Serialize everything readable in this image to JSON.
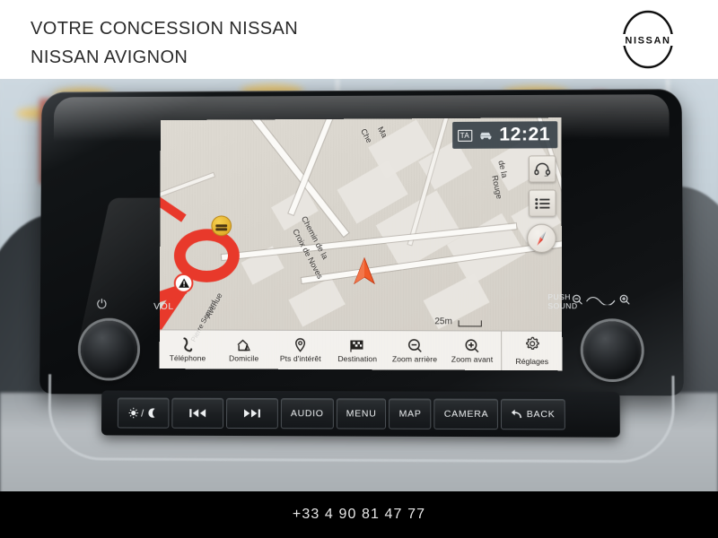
{
  "header": {
    "line1": "VOTRE CONCESSION NISSAN",
    "line2": "NISSAN AVIGNON",
    "logo_text": "NISSAN"
  },
  "footer": {
    "phone": "+33 4 90 81 47 77"
  },
  "infotainment": {
    "status": {
      "ta_badge": "TA",
      "traffic_icon": "car-traffic-icon",
      "clock": "12:21"
    },
    "side_buttons": [
      {
        "name": "headset-icon",
        "label": ""
      },
      {
        "name": "list-icon",
        "label": ""
      },
      {
        "name": "compass-icon",
        "label": ""
      }
    ],
    "map": {
      "scale": "25m",
      "labels": [
        {
          "text": "Chemin de la",
          "rotate": -62
        },
        {
          "text": "Croix de Noves",
          "rotate": -62
        },
        {
          "text": "Avenue",
          "rotate": 62
        },
        {
          "text": "Pierre Semard",
          "rotate": 62
        },
        {
          "text": "Che",
          "rotate": -62
        },
        {
          "text": "Ma",
          "rotate": -62
        },
        {
          "text": "de la",
          "rotate": 78
        },
        {
          "text": "Rouge",
          "rotate": 78
        }
      ],
      "poi_food": "restaurant-poi-icon",
      "warning": "traffic-warning-icon",
      "vehicle": "vehicle-position-arrow"
    },
    "menu": [
      {
        "label": "Téléphone",
        "icon": "phone-icon"
      },
      {
        "label": "Domicile",
        "icon": "home-icon"
      },
      {
        "label": "Pts d'intérêt",
        "icon": "map-pin-icon"
      },
      {
        "label": "Destination",
        "icon": "checkered-flag-icon"
      },
      {
        "label": "Zoom arrière",
        "icon": "zoom-out-icon"
      },
      {
        "label": "Zoom avant",
        "icon": "zoom-in-icon"
      }
    ],
    "settings": {
      "label": "Réglages",
      "icon": "gear-icon"
    }
  },
  "hardware": {
    "left_knob": {
      "power_icon": "power-icon",
      "label": "VOL"
    },
    "right_knob": {
      "label_line1": "PUSH",
      "label_line2": "SOUND",
      "zoom_out_icon": "zoom-out-icon",
      "zoom_in_icon": "zoom-in-icon"
    },
    "buttons": [
      {
        "label": "",
        "icon": "brightness-day-night-icon",
        "type": "icon"
      },
      {
        "label": "",
        "icon": "previous-track-icon",
        "type": "icon"
      },
      {
        "label": "",
        "icon": "next-track-icon",
        "type": "icon"
      },
      {
        "label": "AUDIO",
        "icon": "",
        "type": "text"
      },
      {
        "label": "MENU",
        "icon": "",
        "type": "text"
      },
      {
        "label": "MAP",
        "icon": "",
        "type": "text"
      },
      {
        "label": "CAMERA",
        "icon": "",
        "type": "text"
      },
      {
        "label": "BACK",
        "icon": "back-arrow-icon",
        "type": "text"
      }
    ]
  },
  "colors": {
    "traffic_red": "#e8392b",
    "poi_yellow": "#e2b431",
    "vehicle_orange": "#f05a28",
    "status_bg": "#303a42"
  }
}
